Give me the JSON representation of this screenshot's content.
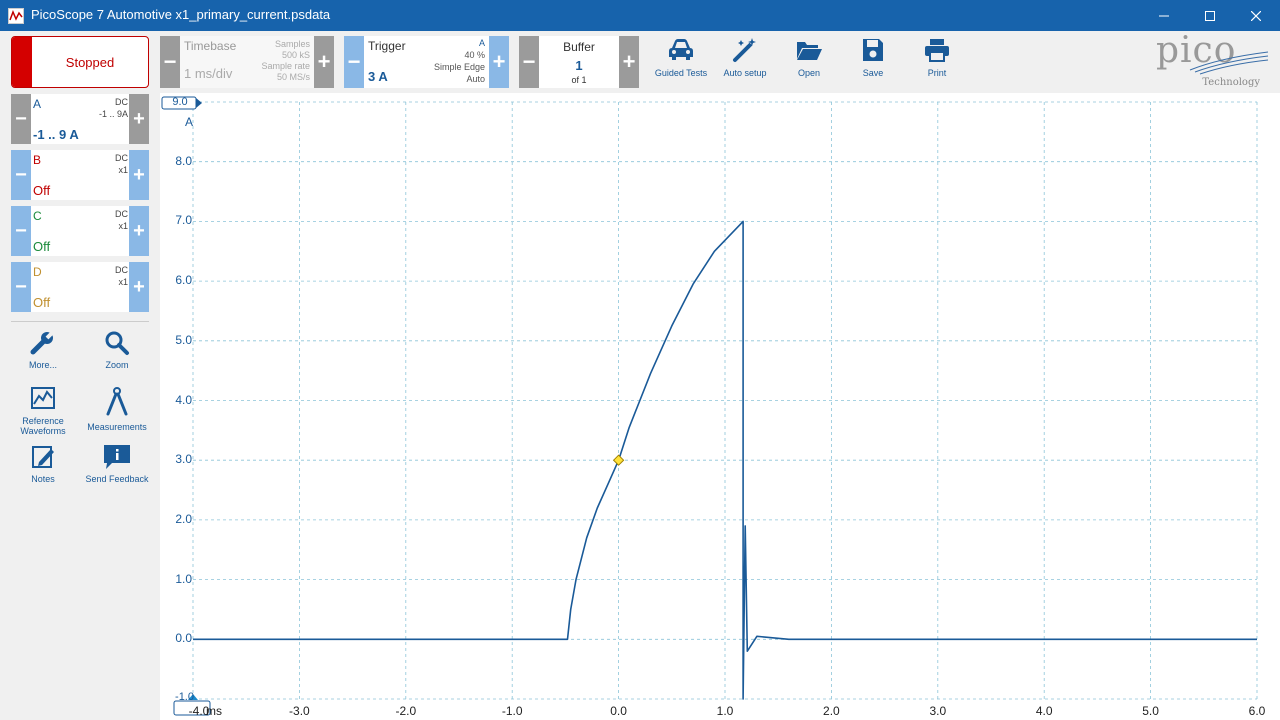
{
  "window": {
    "title": "PicoScope 7 Automotive x1_primary_current.psdata"
  },
  "run_control": {
    "label": "Stopped"
  },
  "timebase": {
    "label": "Timebase",
    "value": "1 ms/div",
    "samples_label": "Samples",
    "samples_value": "500 kS",
    "sample_rate_label": "Sample rate",
    "sample_rate_value": "50 MS/s"
  },
  "trigger": {
    "label": "Trigger",
    "value": "3 A",
    "channel": "A",
    "pretrigger": "40 %",
    "type": "Simple Edge",
    "mode": "Auto"
  },
  "buffer": {
    "label": "Buffer",
    "value": "1",
    "of": "of 1"
  },
  "toolbar": {
    "guided_tests": "Guided Tests",
    "auto_setup": "Auto setup",
    "open": "Open",
    "save": "Save",
    "print": "Print"
  },
  "logo": {
    "name": "pico",
    "sub": "Technology"
  },
  "channels": [
    {
      "letter": "A",
      "coupling": "DC",
      "probe": "-1 .. 9A",
      "value": "-1 .. 9 A",
      "color": "#1a5a98"
    },
    {
      "letter": "B",
      "coupling": "DC",
      "probe": "x1",
      "value": "Off",
      "color": "#c00000"
    },
    {
      "letter": "C",
      "coupling": "DC",
      "probe": "x1",
      "value": "Off",
      "color": "#1a8a3a"
    },
    {
      "letter": "D",
      "coupling": "DC",
      "probe": "x1",
      "value": "Off",
      "color": "#c09030"
    }
  ],
  "sidebar_tools": {
    "more": "More...",
    "zoom": "Zoom",
    "reference_waveforms": "Reference Waveforms",
    "measurements": "Measurements",
    "notes": "Notes",
    "send_feedback": "Send Feedback"
  },
  "plot": {
    "y_unit": "A",
    "y_top_marker": "9.0",
    "y_bottom_marker": "-1.0",
    "x_unit": "ms",
    "y_ticks": [
      "8.0",
      "7.0",
      "6.0",
      "5.0",
      "4.0",
      "3.0",
      "2.0",
      "1.0",
      "0.0"
    ],
    "x_ticks": [
      "-4.0",
      "-3.0",
      "-2.0",
      "-1.0",
      "0.0",
      "1.0",
      "2.0",
      "3.0",
      "4.0",
      "5.0",
      "6.0"
    ],
    "trace_color": "#1a5a98",
    "grid_color": "#8cc4d8",
    "trigger_point": {
      "t_ms": 0.0,
      "amps": 3.0
    },
    "trace": [
      [
        -4.0,
        0.0
      ],
      [
        -0.48,
        0.0
      ],
      [
        -0.45,
        0.5
      ],
      [
        -0.4,
        1.0
      ],
      [
        -0.3,
        1.7
      ],
      [
        -0.2,
        2.2
      ],
      [
        -0.1,
        2.6
      ],
      [
        0.0,
        3.0
      ],
      [
        0.1,
        3.55
      ],
      [
        0.3,
        4.45
      ],
      [
        0.5,
        5.25
      ],
      [
        0.7,
        5.95
      ],
      [
        0.9,
        6.5
      ],
      [
        1.17,
        7.0
      ],
      [
        1.17,
        -1.0
      ],
      [
        1.19,
        1.9
      ],
      [
        1.21,
        -0.2
      ],
      [
        1.3,
        0.05
      ],
      [
        1.6,
        0.0
      ],
      [
        2.0,
        0.0
      ],
      [
        6.0,
        0.0
      ]
    ]
  }
}
